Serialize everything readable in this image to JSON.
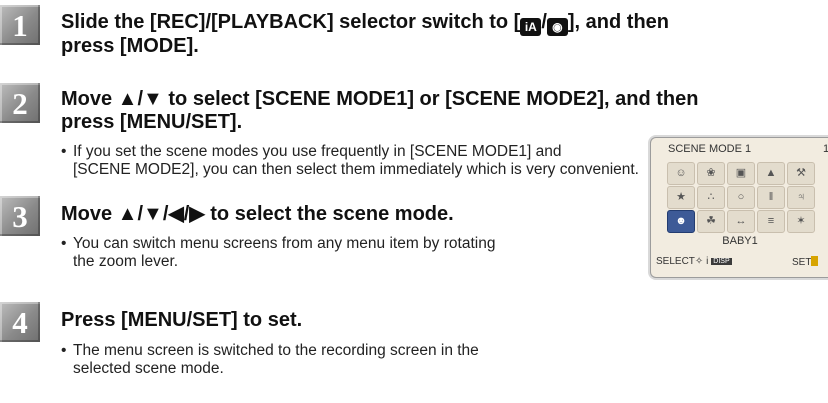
{
  "steps": [
    {
      "number": "1",
      "heading_line1_pre": "Slide the [REC]/[PLAYBACK] selector switch to [",
      "heading_line1_post": "], and then",
      "heading_line2": "press [MODE].",
      "icons": [
        "intelligent-auto-icon",
        "camera-icon"
      ]
    },
    {
      "number": "2",
      "heading_line1": "Move ▲/▼ to select [SCENE MODE1] or [SCENE MODE2], and then",
      "heading_line2": "press [MENU/SET].",
      "bullet_line1": "If you set the scene modes you use frequently in [SCENE MODE1] and",
      "bullet_line2": "[SCENE MODE2], you can then select them immediately which is very convenient."
    },
    {
      "number": "3",
      "heading_line1": "Move ▲/▼/◀/▶ to select the scene mode.",
      "bullet_line1": "You can switch menu screens from any menu item by rotating",
      "bullet_line2": "the zoom lever."
    },
    {
      "number": "4",
      "heading_line1": "Press [MENU/SET] to set.",
      "bullet_line1": "The menu screen is switched to the recording screen in the",
      "bullet_line2": "selected scene mode."
    }
  ],
  "bullet_symbol": "•",
  "lcd": {
    "title": "SCENE MODE 1",
    "page": "1",
    "selected_label": "BABY1",
    "select_hint": "SELECT",
    "set_hint": "SET",
    "icons": [
      "portrait-icon",
      "soft-skin-icon",
      "self-portrait-icon",
      "scenery-icon",
      "sports-icon",
      "night-portrait-icon",
      "night-scenery-icon",
      "food-icon",
      "party-icon",
      "candle-light-icon",
      "baby-icon",
      "pet-icon",
      "sunset-icon",
      "high-sensitivity-icon",
      "starry-sky-icon"
    ]
  }
}
